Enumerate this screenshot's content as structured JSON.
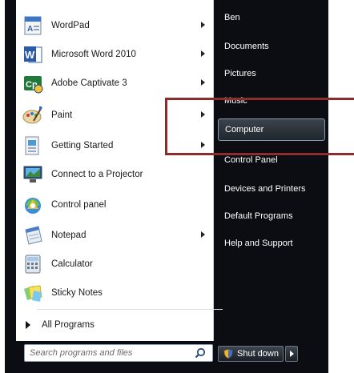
{
  "programs": [
    {
      "label": "WordPad",
      "icon": "wordpad-icon",
      "submenu": true
    },
    {
      "label": "Microsoft Word 2010",
      "icon": "word-icon",
      "submenu": true
    },
    {
      "label": "Adobe Captivate 3",
      "icon": "captivate-icon",
      "submenu": true
    },
    {
      "label": "Paint",
      "icon": "paint-icon",
      "submenu": true
    },
    {
      "label": "Getting Started",
      "icon": "getting-started-icon",
      "submenu": true
    },
    {
      "label": "Connect to a Projector",
      "icon": "projector-icon",
      "submenu": false
    },
    {
      "label": "Control panel",
      "icon": "control-panel-icon",
      "submenu": false
    },
    {
      "label": "Notepad",
      "icon": "notepad-icon",
      "submenu": true
    },
    {
      "label": "Calculator",
      "icon": "calculator-icon",
      "submenu": false
    },
    {
      "label": "Sticky Notes",
      "icon": "sticky-notes-icon",
      "submenu": false
    }
  ],
  "all_programs": "All Programs",
  "search": {
    "placeholder": "Search programs and files"
  },
  "right_items": [
    {
      "label": "Ben"
    },
    {
      "label": "Documents"
    },
    {
      "label": "Pictures"
    },
    {
      "label": "Music"
    },
    {
      "label": "Computer"
    },
    {
      "label": "Control Panel"
    },
    {
      "label": "Devices and Printers"
    },
    {
      "label": "Default Programs"
    },
    {
      "label": "Help and Support"
    }
  ],
  "shutdown": {
    "label": "Shut down"
  },
  "colors": {
    "highlight": "#8b2d2d",
    "menu_bg": "#0b0d12"
  }
}
